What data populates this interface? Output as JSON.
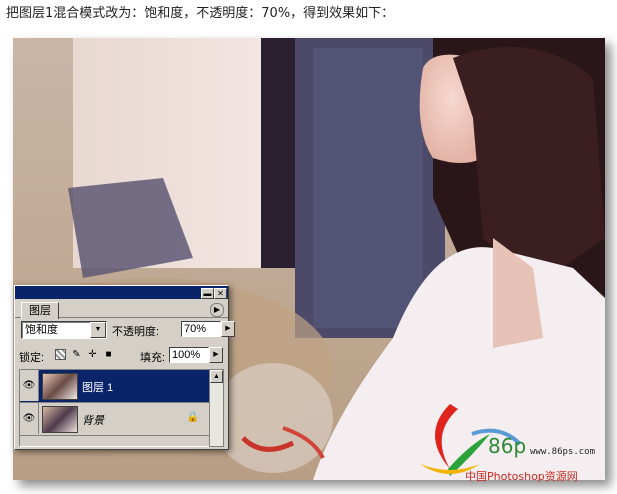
{
  "caption": "把图层1混合模式改为：饱和度，不透明度：70%，得到效果如下：",
  "panel": {
    "tab_label": "图层",
    "blend_mode": "饱和度",
    "opacity_label": "不透明度:",
    "opacity_value": "70%",
    "lock_label": "锁定:",
    "fill_label": "填充:",
    "fill_value": "100%",
    "layers": [
      {
        "name": "图层 1",
        "selected": true
      },
      {
        "name": "背景",
        "selected": false,
        "locked": true
      }
    ]
  },
  "watermark": {
    "site": "www.86ps.com",
    "logo_text": "86p",
    "tagline": "中国Photoshop资源网"
  },
  "colors": {
    "panel_bg": "#d4d0c8",
    "selection": "#0a246a"
  }
}
